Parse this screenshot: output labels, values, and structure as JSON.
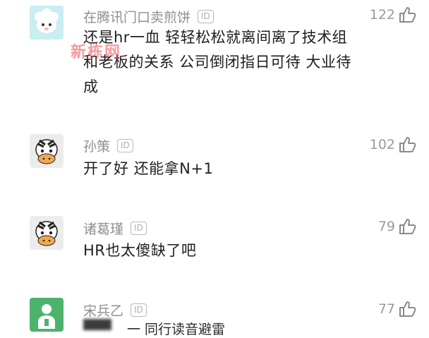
{
  "comments": [
    {
      "username": "在腾讯门口卖煎饼",
      "id_badge": "ID",
      "likes": "122",
      "text_lines": [
        "还是hr一血 轻轻松松就离间离了技术组",
        "和老板的关系 公司倒闭指日可待 大业待",
        "成"
      ],
      "avatar": "sheep-avatar"
    },
    {
      "username": "孙策",
      "id_badge": "ID",
      "likes": "102",
      "text_lines": [
        "开了好 还能拿N+1"
      ],
      "avatar": "zebra-avatar"
    },
    {
      "username": "诸葛瑾",
      "id_badge": "ID",
      "likes": "79",
      "text_lines": [
        "HR也太傻缺了吧"
      ],
      "avatar": "zebra-avatar"
    },
    {
      "username": "宋兵乙",
      "id_badge": "ID",
      "likes": "77",
      "text_lines": [
        "一 同行读音避雷"
      ],
      "avatar": "person-avatar"
    }
  ],
  "watermark": "新栋网",
  "colors": {
    "username": "#8f8f8f",
    "text": "#1e1e1e",
    "like": "#9a9a9a",
    "watermark": "#f04a52"
  }
}
